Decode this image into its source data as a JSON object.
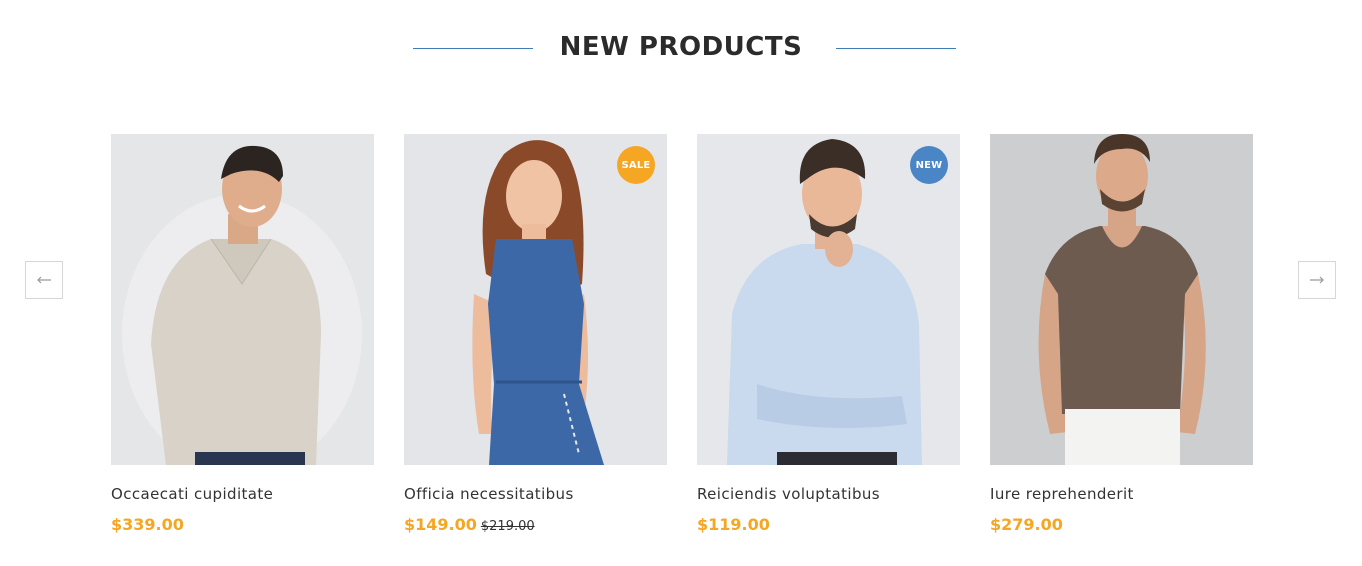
{
  "section": {
    "title": "NEW PRODUCTS",
    "accent_color": "#3f7fb6"
  },
  "navigation": {
    "prev_icon": "arrow-left-icon",
    "next_icon": "arrow-right-icon"
  },
  "products": [
    {
      "name": "Occaecati cupiditate",
      "price": "$339.00",
      "old_price": "",
      "badge": "",
      "image": "man-in-beige-shirt"
    },
    {
      "name": "Officia necessitatibus",
      "price": "$149.00",
      "old_price": "$219.00",
      "badge": "SALE",
      "badge_color": "#f5a623",
      "image": "woman-in-denim-dress"
    },
    {
      "name": "Reiciendis voluptatibus",
      "price": "$119.00",
      "old_price": "",
      "badge": "NEW",
      "badge_color": "#4a86c5",
      "image": "man-in-light-blue-shirt"
    },
    {
      "name": "Iure reprehenderit",
      "price": "$279.00",
      "old_price": "",
      "badge": "",
      "image": "man-in-brown-tshirt"
    }
  ],
  "colors": {
    "price": "#f5a623",
    "sale_badge": "#f5a623",
    "new_badge": "#4a86c5"
  }
}
